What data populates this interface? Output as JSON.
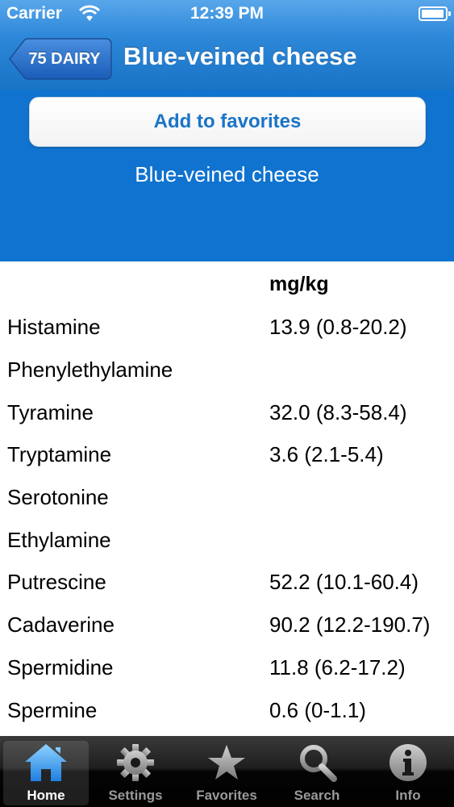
{
  "status_bar": {
    "carrier": "Carrier",
    "time": "12:39 PM"
  },
  "nav": {
    "back_label": "75 DAIRY",
    "title": "Blue-veined cheese"
  },
  "actions": {
    "favorites_label": "Add to favorites"
  },
  "food": {
    "name": "Blue-veined cheese"
  },
  "table": {
    "unit_header": "mg/kg",
    "rows": [
      {
        "name": "Histamine",
        "value": "13.9 (0.8-20.2)"
      },
      {
        "name": "Phenylethylamine",
        "value": ""
      },
      {
        "name": "Tyramine",
        "value": "32.0 (8.3-58.4)"
      },
      {
        "name": "Tryptamine",
        "value": "3.6 (2.1-5.4)"
      },
      {
        "name": "Serotonine",
        "value": ""
      },
      {
        "name": "Ethylamine",
        "value": ""
      },
      {
        "name": "Putrescine",
        "value": "52.2 (10.1-60.4)"
      },
      {
        "name": "Cadaverine",
        "value": "90.2 (12.2-190.7)"
      },
      {
        "name": "Spermidine",
        "value": "11.8 (6.2-17.2)"
      },
      {
        "name": "Spermine",
        "value": "0.6 (0-1.1)"
      }
    ]
  },
  "tab_bar": {
    "tabs": [
      {
        "label": "Home",
        "icon": "home-icon",
        "active": true
      },
      {
        "label": "Settings",
        "icon": "gear-icon",
        "active": false
      },
      {
        "label": "Favorites",
        "icon": "star-icon",
        "active": false
      },
      {
        "label": "Search",
        "icon": "search-icon",
        "active": false
      },
      {
        "label": "Info",
        "icon": "info-icon",
        "active": false
      }
    ]
  },
  "colors": {
    "header_blue": "#2e88d9",
    "band_blue": "#0f73cf",
    "button_text_blue": "#1a74c9",
    "tab_bar": "#000000"
  }
}
